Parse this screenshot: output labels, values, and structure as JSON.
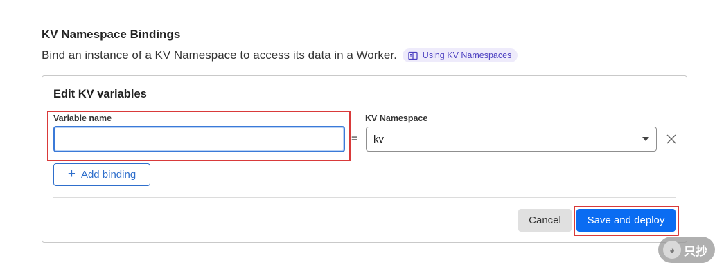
{
  "section": {
    "title": "KV Namespace Bindings",
    "description": "Bind an instance of a KV Namespace to access its data in a Worker.",
    "doc_link_label": "Using KV Namespaces",
    "doc_link_icon": "book-icon"
  },
  "card": {
    "title": "Edit KV variables",
    "variable_name_label": "Variable name",
    "variable_name_value": "",
    "variable_name_placeholder": "",
    "equals_sign": "=",
    "kv_namespace_label": "KV Namespace",
    "kv_namespace_selected": "kv",
    "add_binding_label": "Add binding",
    "cancel_label": "Cancel",
    "save_label": "Save and deploy"
  },
  "watermark": {
    "text": "只抄"
  },
  "colors": {
    "primary": "#0a6cf2",
    "link_pill_bg": "#eeebfb",
    "link_pill_text": "#4b3fc0",
    "highlight": "#d93a3a",
    "focus_border": "#3b7ad8"
  }
}
